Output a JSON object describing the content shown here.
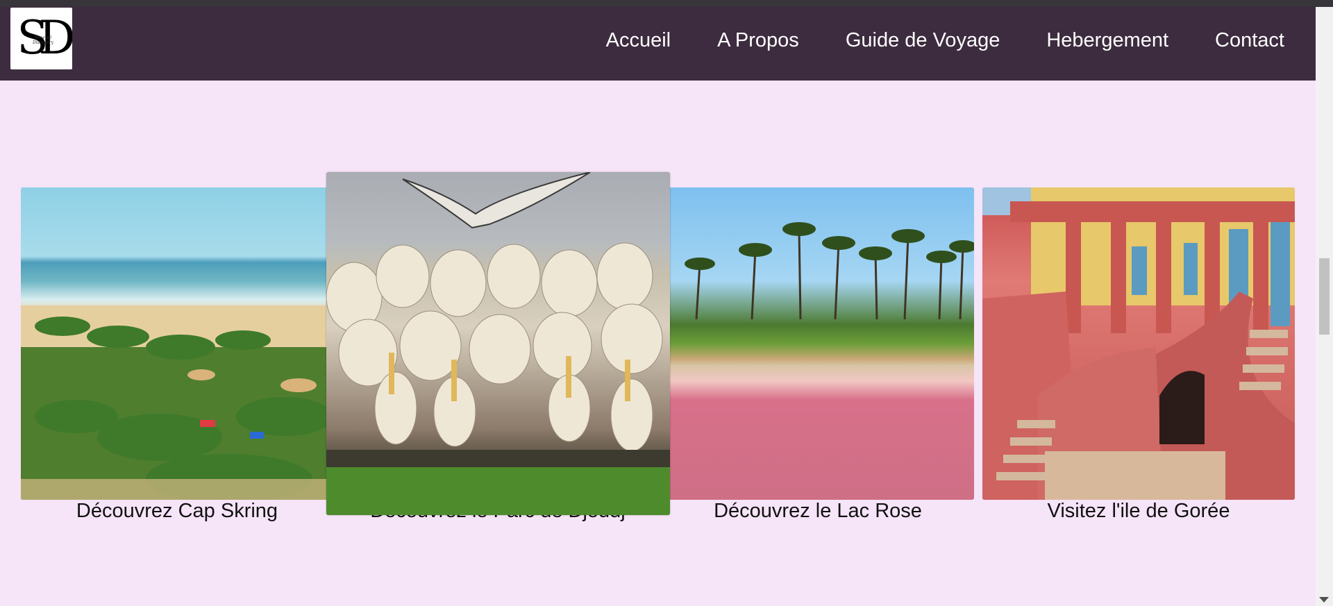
{
  "nav": {
    "logo_text": "SD",
    "logo_subtext": "Senegal Discovery",
    "items": [
      {
        "label": "Accueil"
      },
      {
        "label": "A Propos"
      },
      {
        "label": "Guide de Voyage"
      },
      {
        "label": "Hebergement"
      },
      {
        "label": "Contact"
      }
    ]
  },
  "cards": [
    {
      "caption": "Découvrez Cap Skring",
      "image": "beach-photo"
    },
    {
      "caption": "Découvrez le Parc de Djoudj",
      "image": "pelicans-photo"
    },
    {
      "caption": "Découvrez le Lac Rose",
      "image": "pink-lake-photo"
    },
    {
      "caption": "Visitez l'ile de Gorée",
      "image": "goree-house-photo"
    }
  ]
}
